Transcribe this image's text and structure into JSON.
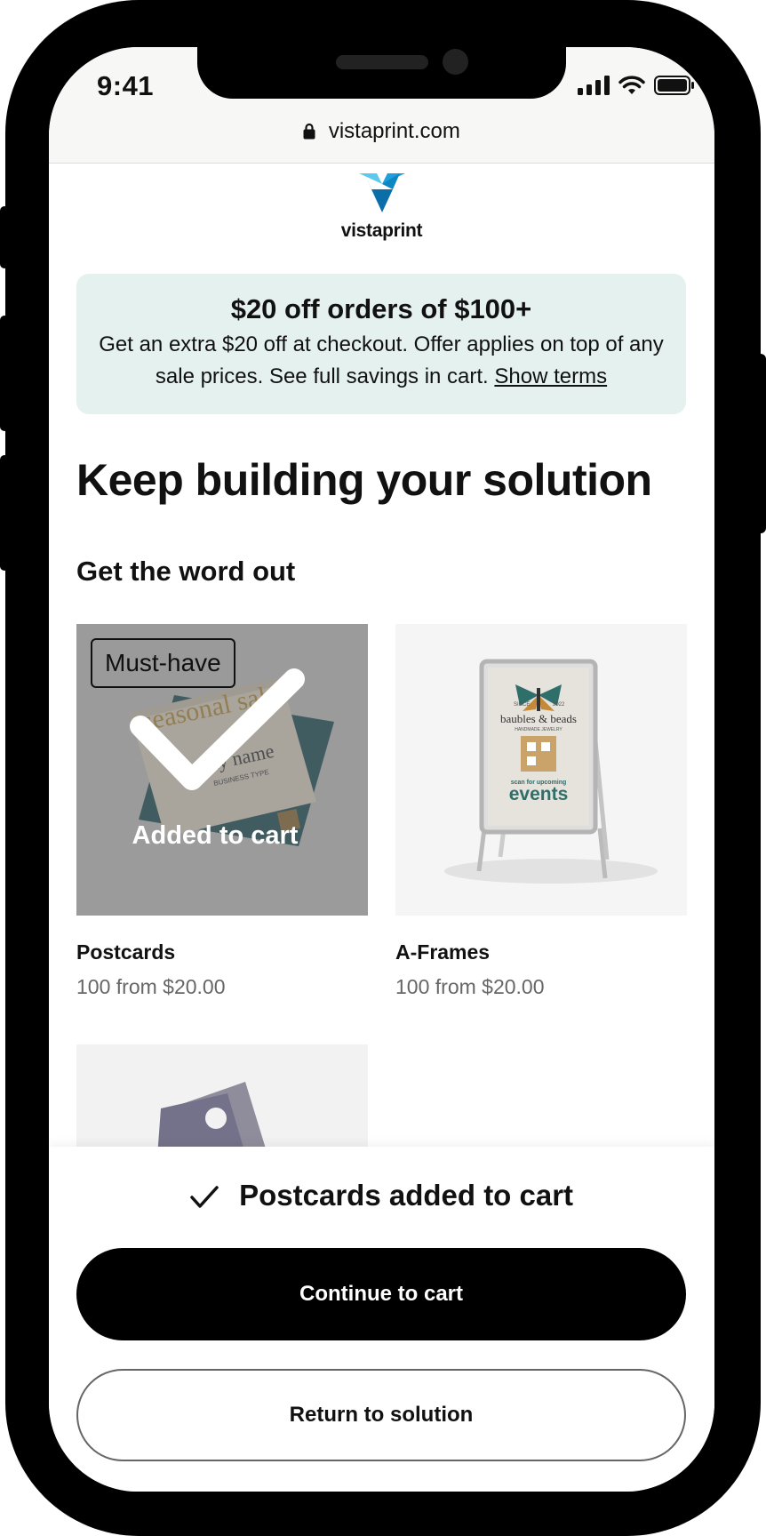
{
  "status_bar": {
    "time": "9:41",
    "url": "vistaprint.com"
  },
  "brand": {
    "logo_text": "vistaprint",
    "logo_colors": [
      "#1fa0dc",
      "#0b6ea8",
      "#5ccaf0"
    ]
  },
  "promo": {
    "title": "$20 off orders of $100+",
    "body": "Get an extra $20 off at checkout. Offer applies on top of any sale prices. See full savings in cart.",
    "link": "Show terms",
    "background": "#e5f1ee"
  },
  "page": {
    "title": "Keep building your solution",
    "section_title": "Get the word out"
  },
  "products": [
    {
      "name": "Postcards",
      "price": "100 from $20.00",
      "badge": "Must-have",
      "overlay": "Added to cart",
      "image_text": {
        "headline": "seasonal sale",
        "name": "ny name",
        "type": "BUSINESS TYPE"
      }
    },
    {
      "name": "A-Frames",
      "price": "100 from $20.00",
      "image_text": {
        "since": "SINCE",
        "year": "2022",
        "shop": "baubles & beads",
        "tagline": "HANDMADE JEWELRY",
        "scan": "scan for upcoming",
        "events": "events"
      }
    }
  ],
  "sheet": {
    "confirmation": "Postcards added to cart",
    "primary_button": "Continue to cart",
    "secondary_button": "Return to solution"
  }
}
